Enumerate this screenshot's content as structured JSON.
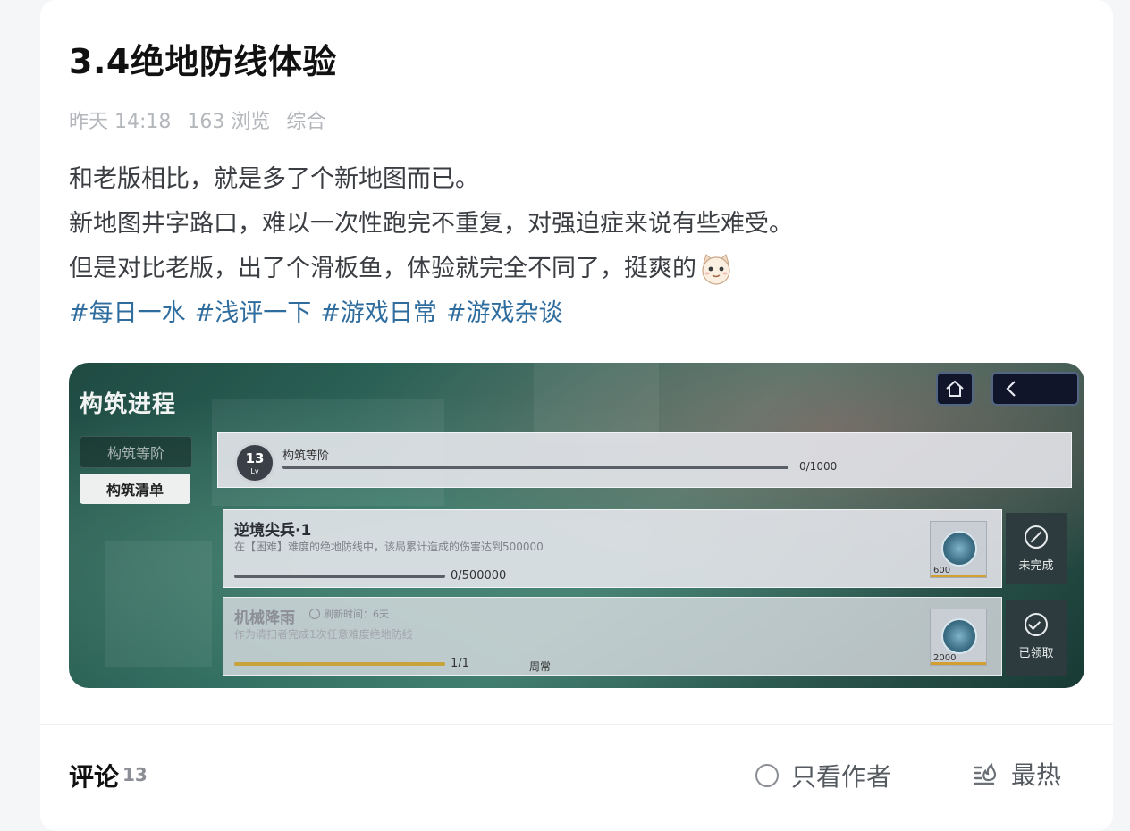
{
  "post": {
    "title": "3.4绝地防线体验",
    "meta": {
      "time": "昨天 14:18",
      "views": "163 浏览",
      "category": "综合"
    },
    "body": [
      "和老版相比，就是多了个新地图而已。",
      "新地图井字路口，难以一次性跑完不重复，对强迫症来说有些难受。",
      "但是对比老版，出了个滑板鱼，体验就完全不同了，挺爽的"
    ],
    "emoji_icon": "cat-face-emoji-icon",
    "tags": [
      "#每日一水",
      "#浅评一下",
      "#游戏日常",
      "#游戏杂谈"
    ]
  },
  "screenshot": {
    "title": "构筑进程",
    "side_tabs": [
      "构筑等阶",
      "构筑清单"
    ],
    "level_panel": {
      "level": "13",
      "level_sub": "Lv",
      "label": "构筑等阶",
      "progress_text": "0/1000"
    },
    "tasks": [
      {
        "name": "逆境尖兵·1",
        "refresh": "",
        "desc": "在【困难】难度的绝地防线中，该局累计造成的伤害达到500000",
        "progress_text": "0/500000",
        "progress": 0.0,
        "type": "",
        "reward": "600",
        "status": "未完成"
      },
      {
        "name": "机械降雨",
        "refresh": "刷新时间：6天",
        "desc": "作为清扫者完成1次任意难度绝地防线",
        "progress_text": "1/1",
        "progress": 1.0,
        "type": "周常",
        "reward": "2000",
        "status": "已领取"
      }
    ]
  },
  "comments": {
    "label": "评论",
    "count": "13",
    "only_author": "只看作者",
    "sort": "最热"
  }
}
